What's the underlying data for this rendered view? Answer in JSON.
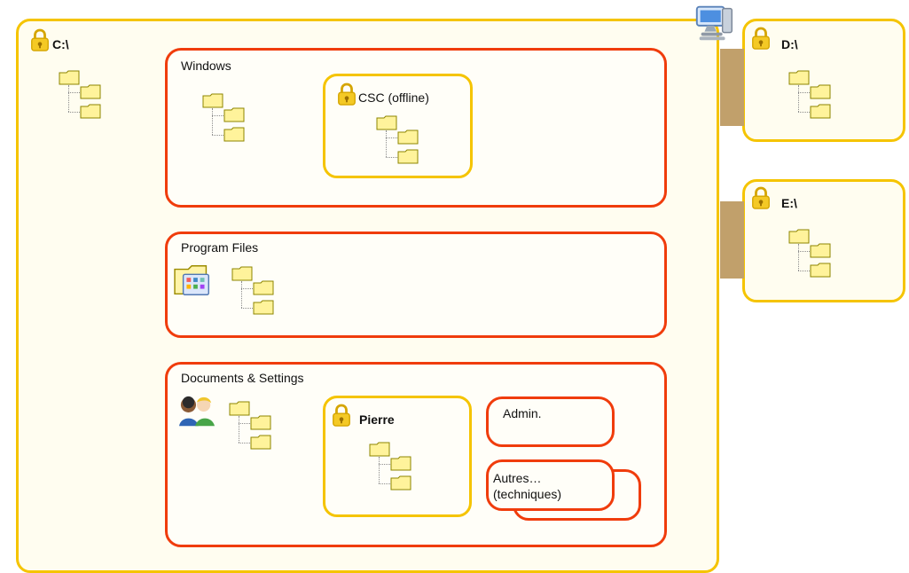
{
  "drives": {
    "c": "C:\\",
    "d": "D:\\",
    "e": "E:\\"
  },
  "sections": {
    "windows": "Windows",
    "program_files": "Program Files",
    "documents_settings": "Documents & Settings"
  },
  "subsections": {
    "csc": "CSC (offline)",
    "pierre": "Pierre",
    "admin": "Admin.",
    "autres": "Autres…\n(techniques)"
  },
  "icons": {
    "lock": "lock-icon",
    "computer": "computer-icon",
    "folder": "folder-icon",
    "program_files": "program-files-icon",
    "users": "users-icon"
  },
  "colors": {
    "drive_border": "#f5c400",
    "zone_border": "#f03c0c",
    "connector": "#c1a06b",
    "background": "#fffdf0"
  }
}
